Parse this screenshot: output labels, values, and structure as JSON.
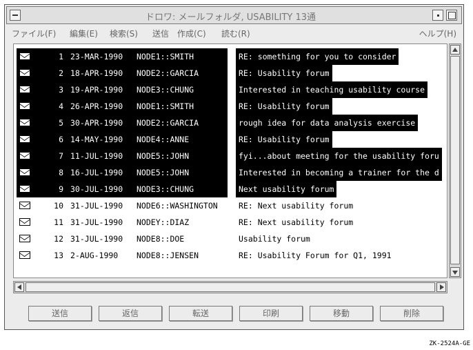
{
  "window": {
    "title": "ドロワ: メールフォルダ, USABILITY 13通"
  },
  "menubar": {
    "items": [
      "ファイル(F)",
      "編集(E)",
      "検索(S)",
      "送信",
      "作成(C)",
      "読む(R)"
    ],
    "help": "ヘルプ(H)"
  },
  "messages": [
    {
      "num": "1",
      "date": "23-MAR-1990",
      "from": "NODE1::SMITH",
      "subject": "RE: something for you to consider",
      "selected": true
    },
    {
      "num": "2",
      "date": "18-APR-1990",
      "from": "NODE2::GARCIA",
      "subject": "RE: Usability forum",
      "selected": true
    },
    {
      "num": "3",
      "date": "19-APR-1990",
      "from": "NODE3::CHUNG",
      "subject": "Interested in teaching usability course",
      "selected": true
    },
    {
      "num": "4",
      "date": "26-APR-1990",
      "from": "NODE1::SMITH",
      "subject": "RE: Usability forum",
      "selected": true
    },
    {
      "num": "5",
      "date": "30-APR-1990",
      "from": "NODE2::GARCIA",
      "subject": "rough idea for data analysis exercise",
      "selected": true
    },
    {
      "num": "6",
      "date": "14-MAY-1990",
      "from": "NODE4::ANNE",
      "subject": "RE: Usability forum",
      "selected": true
    },
    {
      "num": "7",
      "date": "11-JUL-1990",
      "from": "NODE5::JOHN",
      "subject": "fyi...about meeting for the usability foru",
      "selected": true
    },
    {
      "num": "8",
      "date": "16-JUL-1990",
      "from": "NODE5::JOHN",
      "subject": "Interested in becoming a trainer for the d",
      "selected": true
    },
    {
      "num": "9",
      "date": "30-JUL-1990",
      "from": "NODE3::CHUNG",
      "subject": "Next usability forum",
      "selected": true
    },
    {
      "num": "10",
      "date": "31-JUL-1990",
      "from": "NODE6::WASHINGTON",
      "subject": "RE: Next usability forum",
      "selected": false
    },
    {
      "num": "11",
      "date": "31-JUL-1990",
      "from": "NODEY::DIAZ",
      "subject": "RE: Next usability forum",
      "selected": false
    },
    {
      "num": "12",
      "date": "31-JUL-1990",
      "from": "NODE8::DOE",
      "subject": "Usability forum",
      "selected": false
    },
    {
      "num": "13",
      "date": "2-AUG-1990",
      "from": "NODE8::JENSEN",
      "subject": "RE: Usability Forum for Q1, 1991",
      "selected": false
    }
  ],
  "buttons": [
    "送信",
    "返信",
    "転送",
    "印刷",
    "移動",
    "削除"
  ],
  "caption": "ZK-2524A-GE"
}
